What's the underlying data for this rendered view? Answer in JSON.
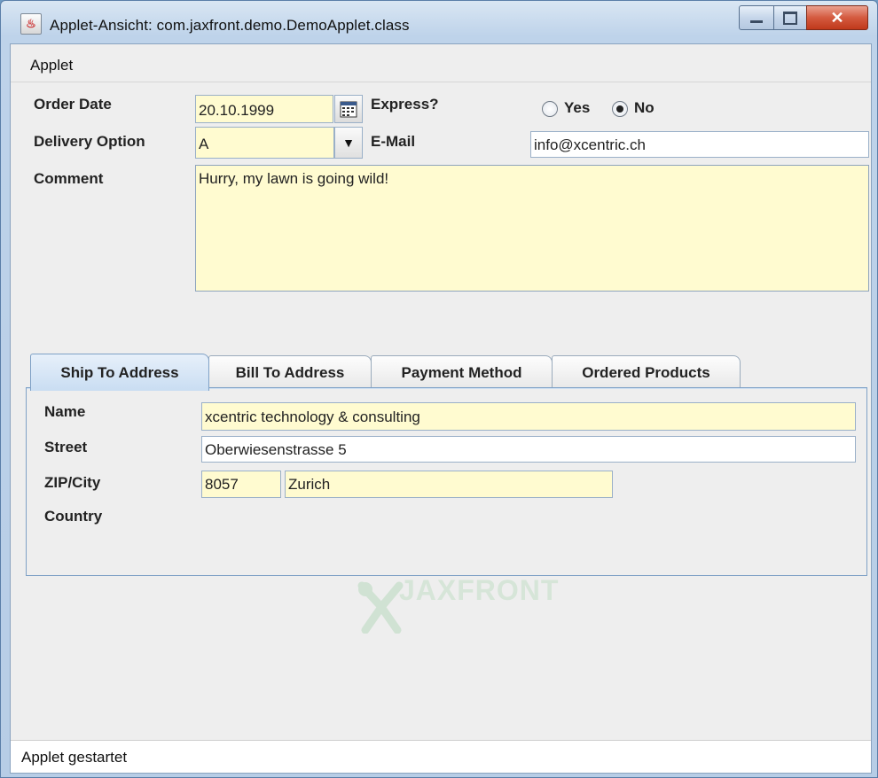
{
  "window": {
    "title": "Applet-Ansicht: com.jaxfront.demo.DemoApplet.class",
    "app_icon": "java-applet-icon",
    "controls": {
      "minimize": "minimize-icon",
      "maximize": "maximize-icon",
      "close": "close-icon"
    }
  },
  "menu": {
    "items": [
      "Applet"
    ]
  },
  "form": {
    "order_date": {
      "label": "Order Date",
      "value": "20.10.1999",
      "icon": "calendar-icon"
    },
    "express": {
      "label": "Express?",
      "options": [
        "Yes",
        "No"
      ],
      "selected": "No"
    },
    "delivery_option": {
      "label": "Delivery Option",
      "value": "A",
      "icon": "chevron-down-icon"
    },
    "email": {
      "label": "E-Mail",
      "value": "info@xcentric.ch"
    },
    "comment": {
      "label": "Comment",
      "value": "Hurry, my lawn is going wild!"
    }
  },
  "tabs": {
    "items": [
      "Ship To Address",
      "Bill To Address",
      "Payment Method",
      "Ordered Products"
    ],
    "active": "Ship To Address"
  },
  "ship_to": {
    "name": {
      "label": "Name",
      "value": "xcentric technology & consulting"
    },
    "street": {
      "label": "Street",
      "value": "Oberwiesenstrasse 5"
    },
    "zip_city": {
      "label": "ZIP/City",
      "zip": "8057",
      "city": "Zurich"
    },
    "country": {
      "label": "Country"
    }
  },
  "logo": {
    "text": "JAXFRONT"
  },
  "status": {
    "text": "Applet gestartet"
  },
  "colors": {
    "required_field": "#fffbd0",
    "tab_active": "#c9ddf2",
    "frame": "#bed3ea"
  }
}
